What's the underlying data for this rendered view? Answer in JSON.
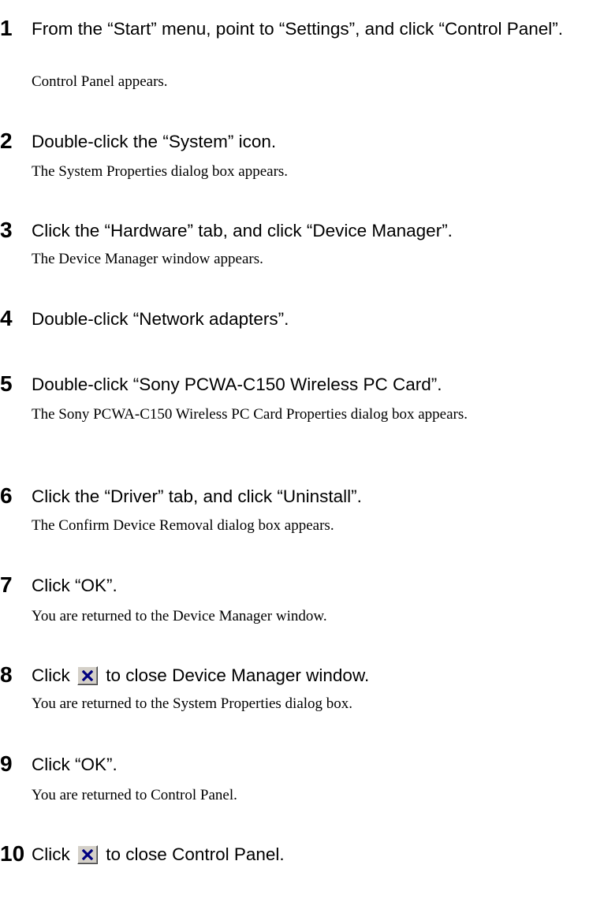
{
  "steps": [
    {
      "number": "1",
      "instruction": "From the “Start” menu, point to “Settings”, and click “Control Panel”.",
      "result": "Control Panel appears."
    },
    {
      "number": "2",
      "instruction": "Double-click the “System” icon.",
      "result": "The System Properties dialog box appears."
    },
    {
      "number": "3",
      "instruction": "Click the “Hardware” tab, and click “Device Manager”.",
      "result": "The Device Manager window appears."
    },
    {
      "number": "4",
      "instruction": "Double-click “Network adapters”."
    },
    {
      "number": "5",
      "instruction": "Double-click “Sony PCWA-C150 Wireless PC Card”.",
      "result": "The Sony PCWA-C150 Wireless PC Card Properties dialog box appears."
    },
    {
      "number": "6",
      "instruction": "Click the “Driver” tab, and click “Uninstall”.",
      "result": "The Confirm Device Removal dialog box appears."
    },
    {
      "number": "7",
      "instruction": "Click “OK”.",
      "result": "You are returned to the Device Manager window."
    },
    {
      "number": "8",
      "instruction_before": "Click",
      "instruction_after": "to close Device Manager window.",
      "icon": "close-x-icon",
      "result": "You are returned to the System Properties dialog box."
    },
    {
      "number": "9",
      "instruction": "Click “OK”.",
      "result": "You are returned to Control Panel."
    },
    {
      "number": "10",
      "instruction_before": "Click",
      "instruction_after": "to close Control Panel.",
      "icon": "close-x-icon"
    }
  ],
  "colors": {
    "text": "#000000",
    "button_face": "#d4d0c8",
    "close_x": "#000080"
  }
}
